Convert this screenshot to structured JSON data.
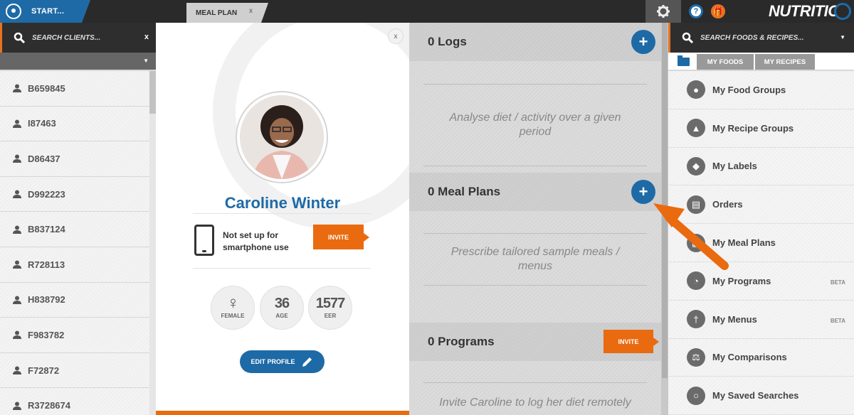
{
  "topbar": {
    "start_label": "START...",
    "meal_tab_label": "MEAL PLAN",
    "meal_tab_close": "x",
    "help_glyph": "?",
    "gift_glyph": "🎁",
    "brand": "NUTRITICS"
  },
  "left": {
    "search_placeholder": "SEARCH CLIENTS...",
    "search_clear": "x",
    "filter_caret": "▼",
    "clients": [
      "B659845",
      "I87463",
      "D86437",
      "D992223",
      "B837124",
      "R728113",
      "H838792",
      "F983782",
      "F72872",
      "R3728674"
    ]
  },
  "profile": {
    "close": "x",
    "name": "Caroline Winter",
    "smartphone_text": "Not set up for smartphone use",
    "invite_label": "INVITE",
    "stats": [
      {
        "value": "♀",
        "label": "FEMALE"
      },
      {
        "value": "36",
        "label": "AGE"
      },
      {
        "value": "1577",
        "label": "EER"
      }
    ],
    "edit_label": "EDIT PROFILE"
  },
  "sections": {
    "logs": {
      "title": "0 Logs",
      "desc": "Analyse diet / activity over a given period",
      "action": "+"
    },
    "meal_plans": {
      "title": "0 Meal Plans",
      "desc": "Prescribe tailored sample meals / menus",
      "action": "+"
    },
    "programs": {
      "title": "0 Programs",
      "desc": "Invite Caroline to log her diet remotely",
      "action": "INVITE"
    }
  },
  "right": {
    "search_placeholder": "SEARCH FOODS & RECIPES...",
    "search_caret": "▼",
    "tabs": [
      "MY FOODS",
      "MY RECIPES"
    ],
    "items": [
      {
        "label": "My Food Groups",
        "icon": "apple-icon",
        "glyph": "●",
        "tag": ""
      },
      {
        "label": "My Recipe Groups",
        "icon": "chef-hat-icon",
        "glyph": "▲",
        "tag": ""
      },
      {
        "label": "My Labels",
        "icon": "tag-icon",
        "glyph": "◆",
        "tag": ""
      },
      {
        "label": "Orders",
        "icon": "document-icon",
        "glyph": "▤",
        "tag": ""
      },
      {
        "label": "My Meal Plans",
        "icon": "calendar-icon",
        "glyph": "▦",
        "tag": ""
      },
      {
        "label": "My Programs",
        "icon": "program-icon",
        "glyph": "◔",
        "tag": "BETA"
      },
      {
        "label": "My Menus",
        "icon": "cutlery-icon",
        "glyph": "†",
        "tag": "BETA"
      },
      {
        "label": "My Comparisons",
        "icon": "scale-icon",
        "glyph": "⚖",
        "tag": ""
      },
      {
        "label": "My Saved Searches",
        "icon": "search-icon",
        "glyph": "○",
        "tag": ""
      }
    ]
  },
  "colors": {
    "accent_blue": "#1e6aa6",
    "accent_orange": "#ea6a0f",
    "dark_bar": "#2a2a2a"
  }
}
